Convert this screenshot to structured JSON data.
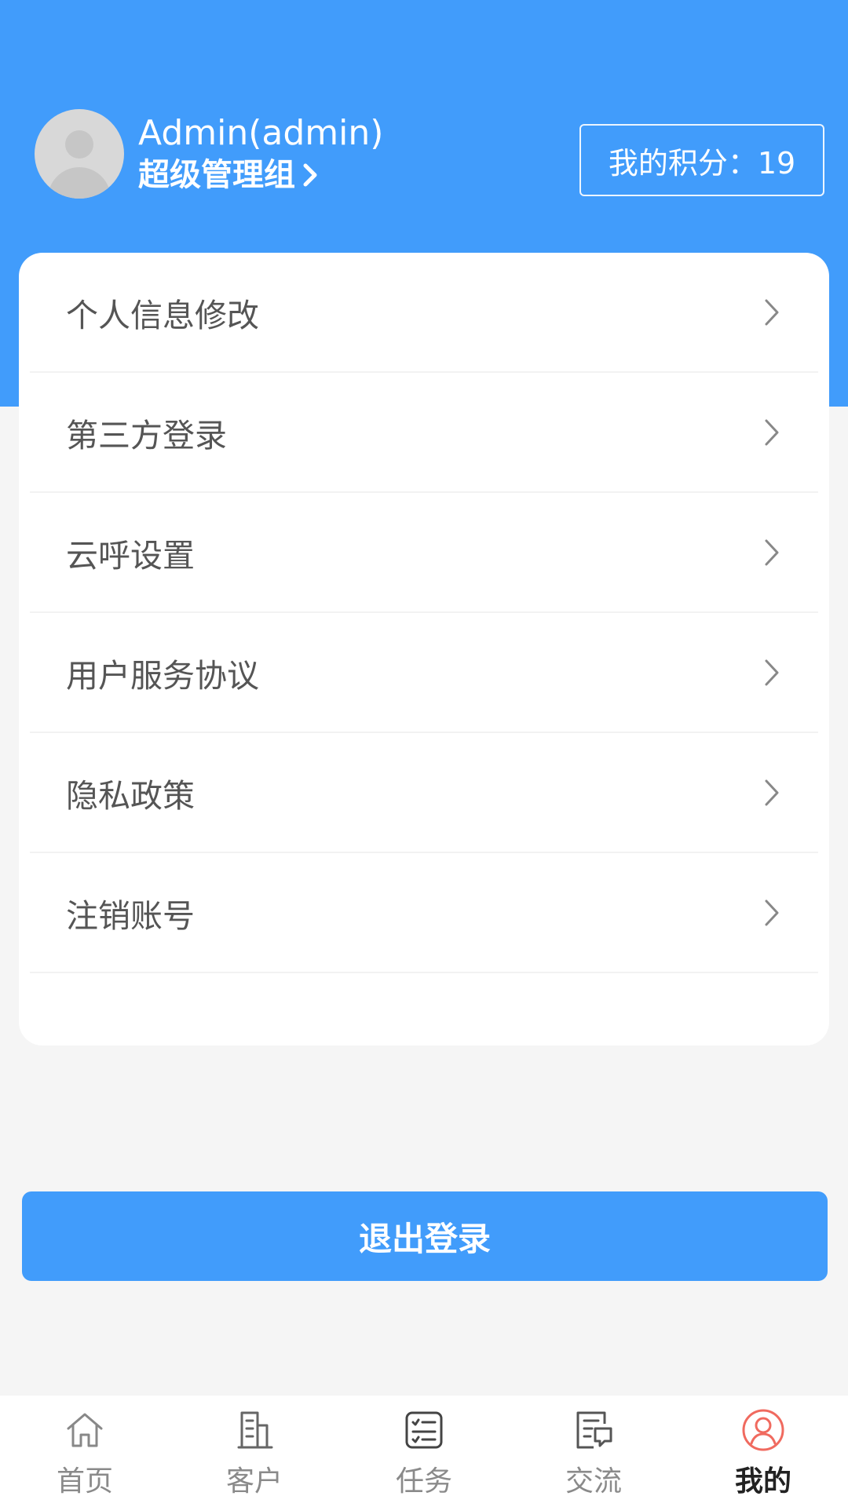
{
  "user": {
    "name": "Admin(admin)",
    "group": "超级管理组"
  },
  "points": {
    "label": "我的积分：19"
  },
  "menu": {
    "items": [
      {
        "label": "个人信息修改"
      },
      {
        "label": "第三方登录"
      },
      {
        "label": "云呼设置"
      },
      {
        "label": "用户服务协议"
      },
      {
        "label": "隐私政策"
      },
      {
        "label": "注销账号"
      }
    ]
  },
  "logout": {
    "label": "退出登录"
  },
  "tabbar": {
    "items": [
      {
        "label": "首页",
        "icon": "home-icon"
      },
      {
        "label": "客户",
        "icon": "building-icon"
      },
      {
        "label": "任务",
        "icon": "task-list-icon"
      },
      {
        "label": "交流",
        "icon": "chat-document-icon"
      },
      {
        "label": "我的",
        "icon": "user-circle-icon",
        "active": true
      }
    ]
  },
  "colors": {
    "brand_blue": "#419cfb",
    "active_tab_icon": "#f06a5f"
  }
}
